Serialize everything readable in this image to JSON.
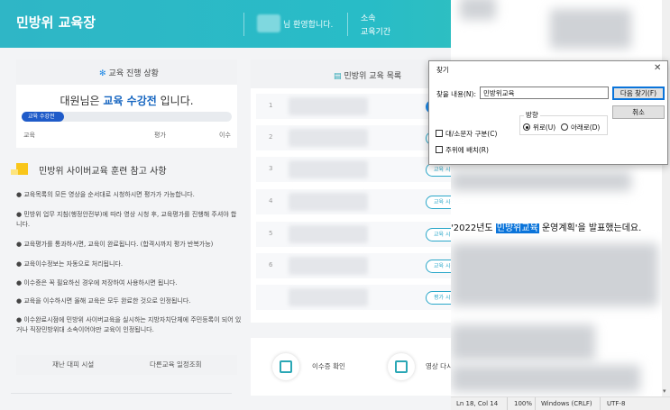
{
  "header": {
    "site_title": "민방위 교육장",
    "welcome": "님 환영합니다.",
    "affiliation_label": "소속",
    "period_label": "교육기간"
  },
  "progress": {
    "title": "교육 진행 상황",
    "status_prefix": "대원님은 ",
    "status_highlight": "교육 수강전",
    "status_suffix": " 입니다.",
    "badge": "교육 수강전",
    "progress_fraction": 0.2,
    "steps": [
      "교육",
      "평가",
      "이수"
    ]
  },
  "notice": {
    "title": "민방위 사이버교육 훈련 참고 사항",
    "items": [
      "교육목록의 모든 영상을 순서대로 시청하시면 평가가 가능합니다.",
      "민방위 업무 지침(행정안전부)에 따라 영상 시청 후, 교육평가를 진행해 주셔야 합니다.",
      "교육평가를 통과하시면, 교육이 완료됩니다. (합격시까지 평가 반복가능)",
      "교육이수정보는 자동으로 처리됩니다.",
      "이수증은 꼭 필요하신 경우에 저장하여 사용하시면 됩니다.",
      "교육을 이수하시면 올해 교육은 모두 완료한 것으로 인정됩니다.",
      "이수완료시점에 민방위 사이버교육을 실시하는 지방자치단체에 주민등록이 되어 있거나 직장민방위대 소속이어야만 교육이 인정됩니다."
    ]
  },
  "bottom_links": {
    "shelter": "재난 대피 시설",
    "other_schedule": "다른교육 일정조회"
  },
  "list": {
    "title": "민방위 교육 목록",
    "rows": [
      {
        "num": "1",
        "btn": "교육 시청",
        "solid": true
      },
      {
        "num": "2",
        "btn": "교육 시청",
        "solid": false
      },
      {
        "num": "3",
        "btn": "교육 시청",
        "solid": false
      },
      {
        "num": "4",
        "btn": "교육 시청",
        "solid": false
      },
      {
        "num": "5",
        "btn": "교육 시청",
        "solid": false
      },
      {
        "num": "6",
        "btn": "교육 시청",
        "solid": false
      },
      {
        "num": "",
        "btn": "평가 시작",
        "solid": false
      }
    ]
  },
  "cert": {
    "certificate": "이수증 확인",
    "video": "영상 다시보기"
  },
  "document": {
    "before": "'2022년도 ",
    "highlight": "민방위교육",
    "after": " 운영계획'을 발표했는데요."
  },
  "statusbar": {
    "position": "Ln 18, Col 14",
    "zoom": "100%",
    "eol": "Windows (CRLF)",
    "encoding": "UTF-8"
  },
  "find_dialog": {
    "title": "찾기",
    "find_label": "찾을 내용(N):",
    "find_value": "민방위교육",
    "find_next": "다음 찾기(F)",
    "cancel": "취소",
    "direction_label": "방향",
    "up": "위로(U)",
    "down": "아래로(D)",
    "match_case": "대/소문자 구분(C)",
    "wrap": "주위에 배치(R)"
  }
}
